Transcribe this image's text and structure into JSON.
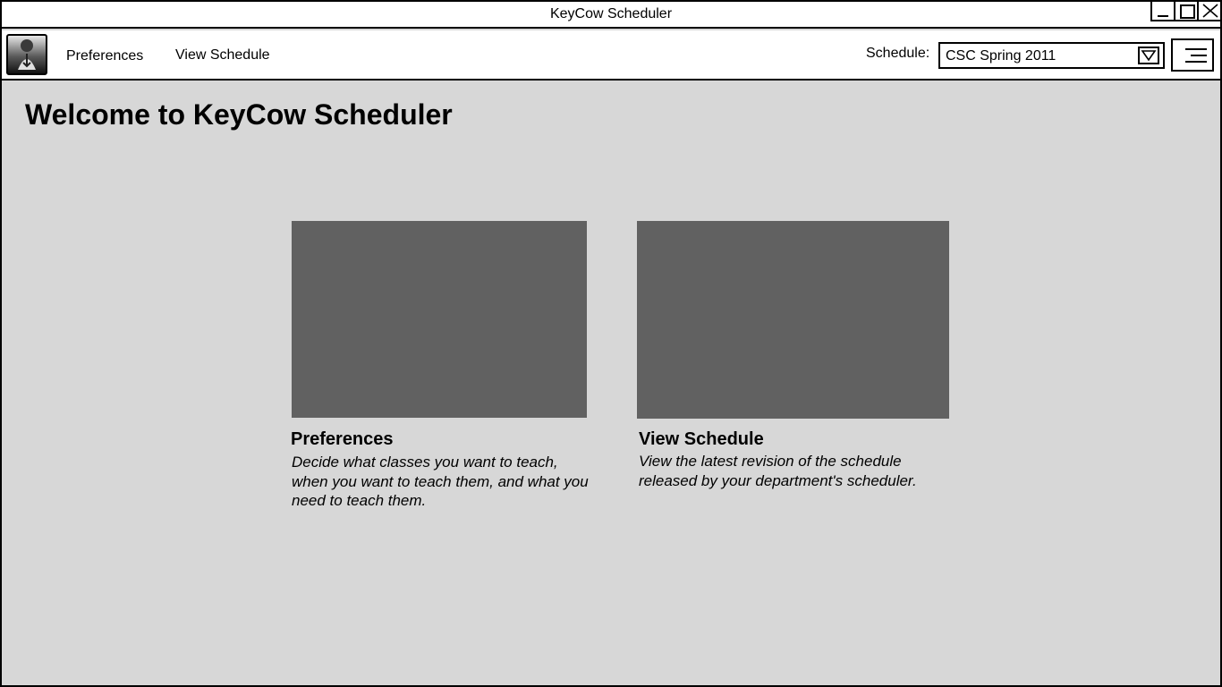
{
  "window": {
    "title": "KeyCow Scheduler"
  },
  "toolbar": {
    "logo_icon": "user-profile-icon",
    "nav": [
      {
        "label": "Preferences"
      },
      {
        "label": "View Schedule"
      }
    ],
    "schedule_label": "Schedule:",
    "schedule_value": "CSC Spring 2011",
    "menu_icon": "hamburger-menu-icon"
  },
  "main": {
    "heading": "Welcome to KeyCow Scheduler",
    "cards": [
      {
        "title": "Preferences",
        "description": "Decide what classes you want to teach, when you want to teach them, and what you need to teach them."
      },
      {
        "title": "View Schedule",
        "description": "View the latest revision of the schedule released by your department's scheduler."
      }
    ]
  },
  "colors": {
    "background": "#d7d7d7",
    "image_placeholder": "#616161",
    "border": "#000000"
  }
}
